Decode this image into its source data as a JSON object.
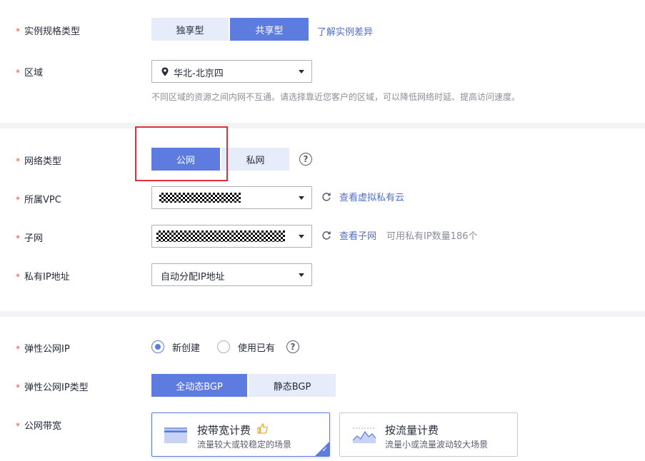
{
  "spec": {
    "label": "实例规格类型",
    "options": [
      "独享型",
      "共享型"
    ],
    "selected": "共享型",
    "link": "了解实例差异"
  },
  "region": {
    "label": "区域",
    "value": "华北-北京四",
    "hint": "不同区域的资源之间内网不互通。请选择靠近您客户的区域，可以降低网络时延、提高访问速度。"
  },
  "network": {
    "label": "网络类型",
    "options": [
      "公网",
      "私网"
    ],
    "selected": "公网"
  },
  "vpc": {
    "label": "所属VPC",
    "link": "查看虚拟私有云"
  },
  "subnet": {
    "label": "子网",
    "link": "查看子网",
    "hint": "可用私有IP数量186个"
  },
  "private_ip": {
    "label": "私有IP地址",
    "value": "自动分配IP地址"
  },
  "eip": {
    "label": "弹性公网IP",
    "options": [
      "新创建",
      "使用已有"
    ],
    "selected": "新创建"
  },
  "eip_type": {
    "label": "弹性公网IP类型",
    "options": [
      "全动态BGP",
      "静态BGP"
    ],
    "selected": "全动态BGP"
  },
  "bandwidth": {
    "label": "公网带宽",
    "cards": [
      {
        "title": "按带宽计费",
        "desc": "流量较大或较稳定的场景"
      },
      {
        "title": "按流量计费",
        "desc": "流量小或流量波动较大场景"
      }
    ],
    "selected": "按带宽计费"
  },
  "colors": {
    "primary": "#5e7ce0",
    "segment_off": "#e6ecfa",
    "required": "#e6593a",
    "highlight": "#e0303a"
  }
}
